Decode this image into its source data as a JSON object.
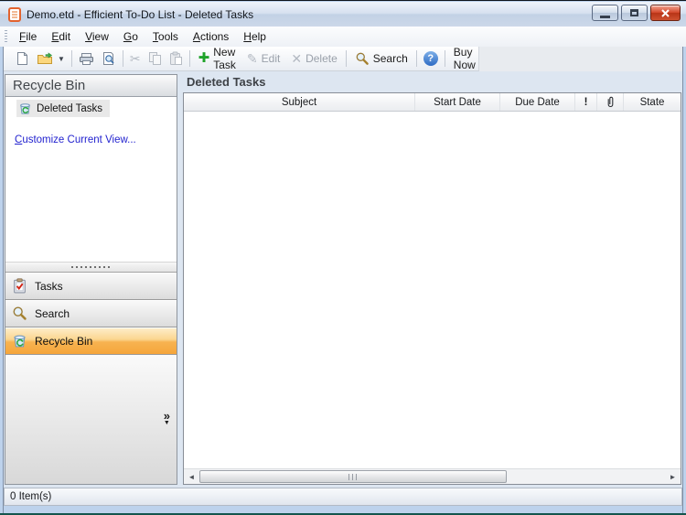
{
  "window": {
    "title": "Demo.etd - Efficient To-Do List - Deleted Tasks",
    "controls": {
      "minimize": "minimize-button",
      "maximize": "maximize-button",
      "close": "close-button"
    }
  },
  "menu_bar": {
    "items": [
      "File",
      "Edit",
      "View",
      "Go",
      "Tools",
      "Actions",
      "Help"
    ]
  },
  "toolbar": {
    "new_task_label": "New Task",
    "edit_label": "Edit",
    "delete_label": "Delete",
    "search_label": "Search",
    "buy_now_label": "Buy Now",
    "icons": {
      "new_document": "blank-page",
      "open_file": "yellow-folder-green-arrow",
      "open_dropdown": "▾",
      "print": "printer",
      "print_preview": "page-with-magnifier",
      "cut": "✂",
      "copy": "two-pages",
      "paste": "clipboard",
      "new_task_plus": "✚",
      "edit_pencil": "✎",
      "delete_x": "✕",
      "search_magnifier": "gold-magnifier",
      "help": "?"
    }
  },
  "sidebar": {
    "header": "Recycle Bin",
    "tree_items": [
      {
        "label": "Deleted Tasks",
        "icon": "recycle-bin-icon",
        "selected": true
      }
    ],
    "link": "Customize Current View...",
    "nav_buttons": [
      {
        "label": "Tasks",
        "icon": "tasks-icon",
        "selected": false
      },
      {
        "label": "Search",
        "icon": "search-icon",
        "selected": false
      },
      {
        "label": "Recycle Bin",
        "icon": "recycle-bin-icon",
        "selected": true
      }
    ],
    "collapse_chevron": "»"
  },
  "main": {
    "header": "Deleted Tasks",
    "columns": [
      {
        "label": "Subject"
      },
      {
        "label": "Start Date"
      },
      {
        "label": "Due Date"
      },
      {
        "label": "!"
      },
      {
        "icon": "paperclip-icon"
      },
      {
        "label": "State"
      }
    ],
    "rows": []
  },
  "status_bar": {
    "text": "0 Item(s)"
  },
  "colors": {
    "accent_orange": "#f7b351",
    "link_blue": "#2323cf",
    "close_red": "#d4492c",
    "new_task_green": "#1fa32a",
    "client_bg": "#dde6f1"
  }
}
